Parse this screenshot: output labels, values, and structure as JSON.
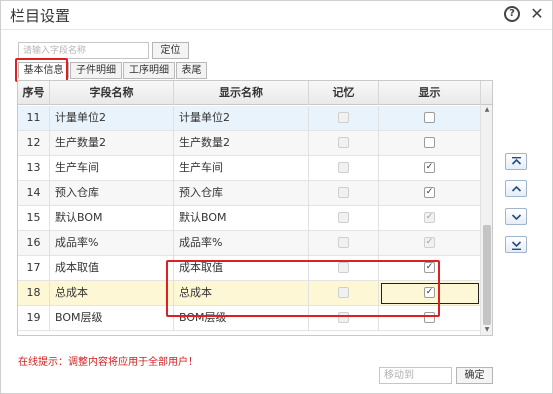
{
  "dialog": {
    "title": "栏目设置",
    "help_glyph": "?",
    "close_glyph": "✕"
  },
  "search": {
    "placeholder": "请输入字段名称",
    "value": "",
    "locate_label": "定位"
  },
  "tabs": [
    {
      "label": "基本信息",
      "active": true
    },
    {
      "label": "子件明细",
      "active": false
    },
    {
      "label": "工序明细",
      "active": false
    },
    {
      "label": "表尾",
      "active": false
    }
  ],
  "grid": {
    "columns": [
      "序号",
      "字段名称",
      "显示名称",
      "记忆",
      "显示"
    ],
    "rows": [
      {
        "seq": "11",
        "field": "计量单位2",
        "display": "计量单位2",
        "memory": false,
        "memory_disabled": true,
        "show": false,
        "show_disabled": false
      },
      {
        "seq": "12",
        "field": "生产数量2",
        "display": "生产数量2",
        "memory": false,
        "memory_disabled": true,
        "show": false,
        "show_disabled": false
      },
      {
        "seq": "13",
        "field": "生产车间",
        "display": "生产车间",
        "memory": false,
        "memory_disabled": true,
        "show": true,
        "show_disabled": false
      },
      {
        "seq": "14",
        "field": "预入仓库",
        "display": "预入仓库",
        "memory": false,
        "memory_disabled": true,
        "show": true,
        "show_disabled": false
      },
      {
        "seq": "15",
        "field": "默认BOM",
        "display": "默认BOM",
        "memory": false,
        "memory_disabled": true,
        "show": true,
        "show_disabled": true
      },
      {
        "seq": "16",
        "field": "成品率%",
        "display": "成品率%",
        "memory": false,
        "memory_disabled": true,
        "show": true,
        "show_disabled": true
      },
      {
        "seq": "17",
        "field": "成本取值",
        "display": "成本取值",
        "memory": false,
        "memory_disabled": true,
        "show": true,
        "show_disabled": false
      },
      {
        "seq": "18",
        "field": "总成本",
        "display": "总成本",
        "memory": false,
        "memory_disabled": true,
        "show": true,
        "show_disabled": false
      },
      {
        "seq": "19",
        "field": "BOM层级",
        "display": "BOM层级",
        "memory": false,
        "memory_disabled": true,
        "show": false,
        "show_disabled": false
      }
    ],
    "selected_row": 0,
    "highlighted_row": 7
  },
  "order_buttons": [
    {
      "name": "move-top-button",
      "icon": "double-up-arrow-icon"
    },
    {
      "name": "move-up-button",
      "icon": "up-arrow-icon"
    },
    {
      "name": "move-down-button",
      "icon": "down-arrow-icon"
    },
    {
      "name": "move-bottom-button",
      "icon": "double-down-arrow-icon"
    }
  ],
  "footer": {
    "hint": "在线提示：调整内容将应用于全部用户！",
    "move_placeholder": "移动到",
    "ok_label": "确定"
  },
  "colors": {
    "annotation_red": "#e02020",
    "hint_red": "#d21f1f",
    "selected_row": "#e9f3fb",
    "highlighted_row": "#fdf7d6"
  }
}
